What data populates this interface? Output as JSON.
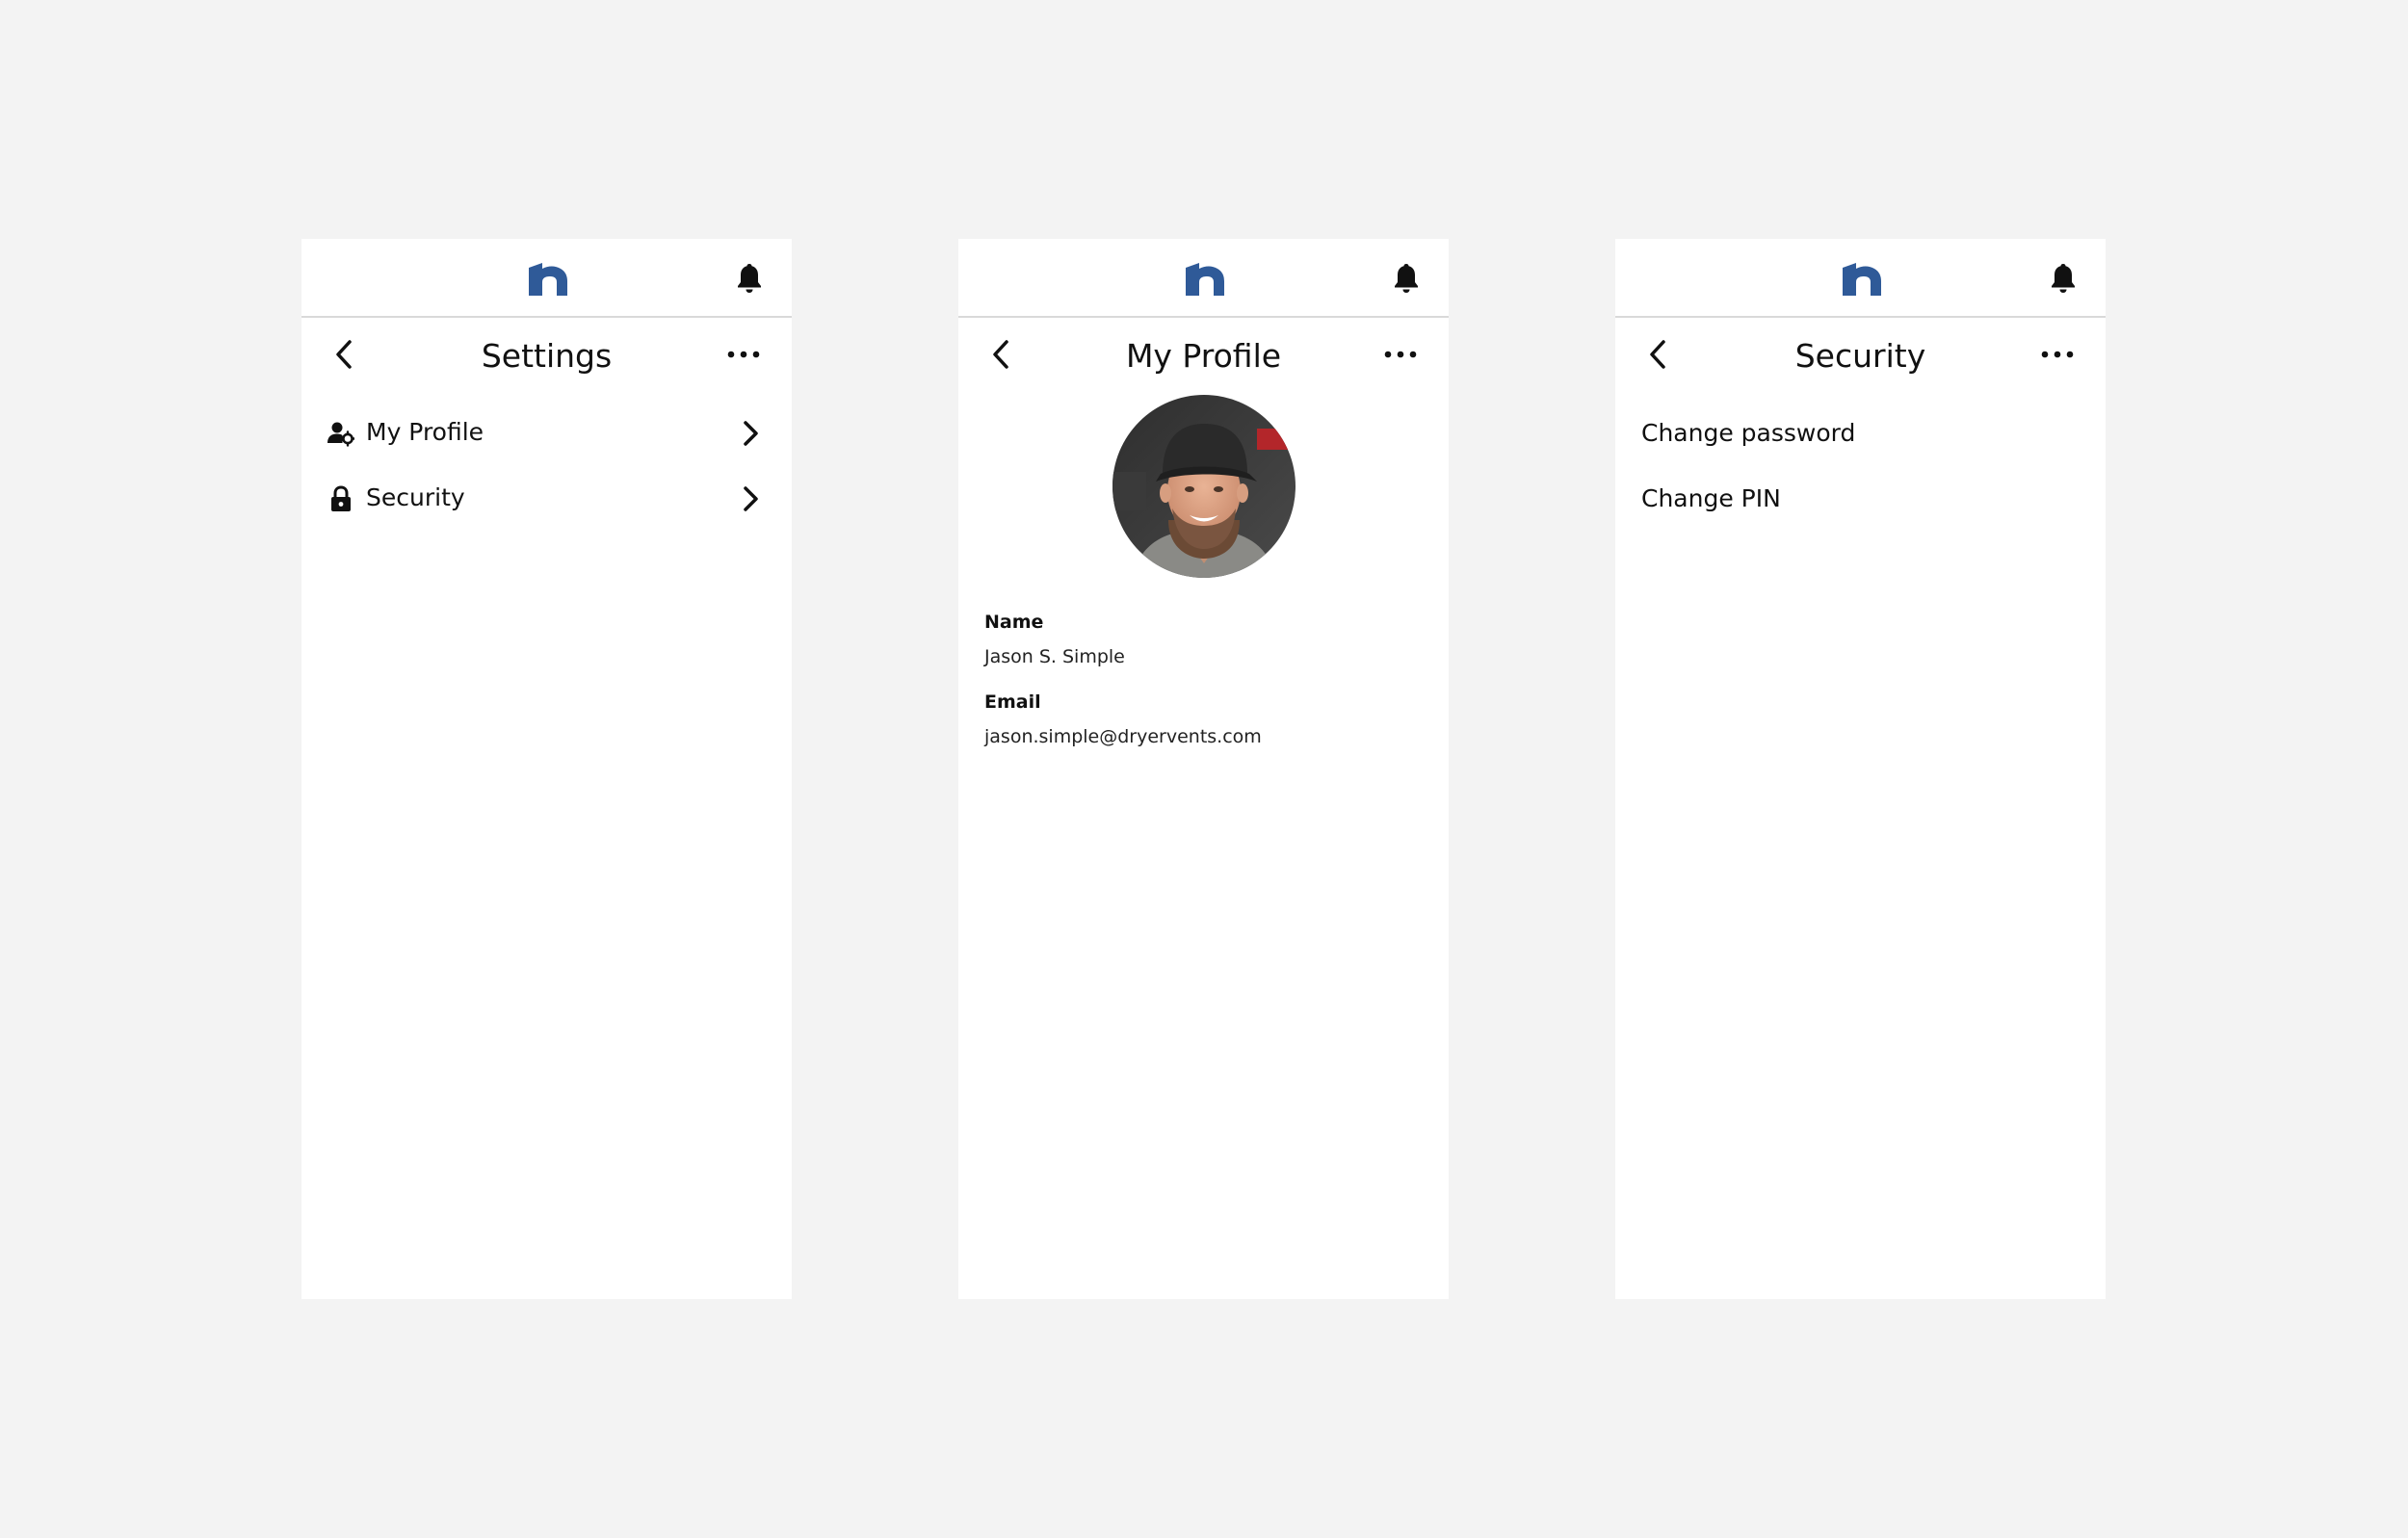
{
  "colors": {
    "background": "#f3f3f3",
    "panel": "#ffffff",
    "brand": "#2f5a98",
    "divider": "#d9d9d9"
  },
  "icons": {
    "logo": "brand-logo-n",
    "bell": "bell-icon",
    "back": "chevron-left-icon",
    "more": "more-horizontal-icon",
    "profile_row": "user-gear-icon",
    "security_row": "lock-icon",
    "row_arrow": "chevron-right-icon"
  },
  "settings": {
    "title": "Settings",
    "items": [
      {
        "label": "My Profile",
        "icon": "user-gear-icon"
      },
      {
        "label": "Security",
        "icon": "lock-icon"
      }
    ]
  },
  "profile": {
    "title": "My Profile",
    "name_label": "Name",
    "name_value": "Jason S. Simple",
    "email_label": "Email",
    "email_value": "jason.simple@dryervents.com"
  },
  "security": {
    "title": "Security",
    "items": [
      {
        "label": "Change password"
      },
      {
        "label": "Change PIN"
      }
    ]
  }
}
